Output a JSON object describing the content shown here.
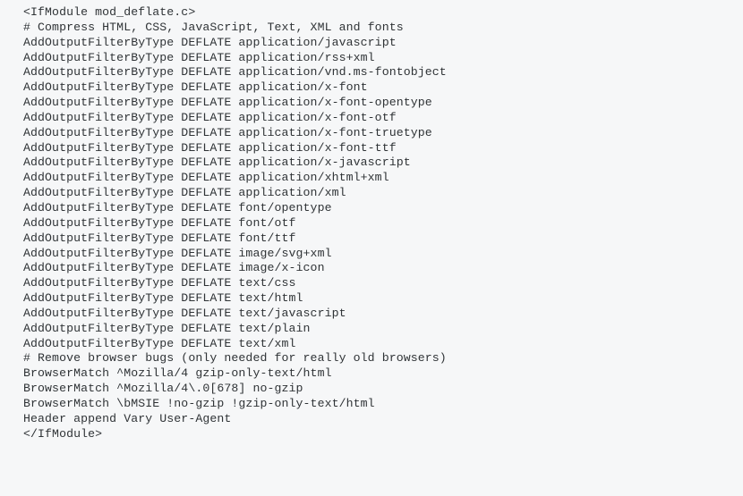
{
  "code": {
    "lines": [
      "<IfModule mod_deflate.c>",
      "# Compress HTML, CSS, JavaScript, Text, XML and fonts",
      "AddOutputFilterByType DEFLATE application/javascript",
      "AddOutputFilterByType DEFLATE application/rss+xml",
      "AddOutputFilterByType DEFLATE application/vnd.ms-fontobject",
      "AddOutputFilterByType DEFLATE application/x-font",
      "AddOutputFilterByType DEFLATE application/x-font-opentype",
      "AddOutputFilterByType DEFLATE application/x-font-otf",
      "AddOutputFilterByType DEFLATE application/x-font-truetype",
      "AddOutputFilterByType DEFLATE application/x-font-ttf",
      "AddOutputFilterByType DEFLATE application/x-javascript",
      "AddOutputFilterByType DEFLATE application/xhtml+xml",
      "AddOutputFilterByType DEFLATE application/xml",
      "AddOutputFilterByType DEFLATE font/opentype",
      "AddOutputFilterByType DEFLATE font/otf",
      "AddOutputFilterByType DEFLATE font/ttf",
      "AddOutputFilterByType DEFLATE image/svg+xml",
      "AddOutputFilterByType DEFLATE image/x-icon",
      "AddOutputFilterByType DEFLATE text/css",
      "AddOutputFilterByType DEFLATE text/html",
      "AddOutputFilterByType DEFLATE text/javascript",
      "AddOutputFilterByType DEFLATE text/plain",
      "AddOutputFilterByType DEFLATE text/xml",
      "",
      "# Remove browser bugs (only needed for really old browsers)",
      "BrowserMatch ^Mozilla/4 gzip-only-text/html",
      "BrowserMatch ^Mozilla/4\\.0[678] no-gzip",
      "BrowserMatch \\bMSIE !no-gzip !gzip-only-text/html",
      "Header append Vary User-Agent",
      "</IfModule>"
    ]
  }
}
